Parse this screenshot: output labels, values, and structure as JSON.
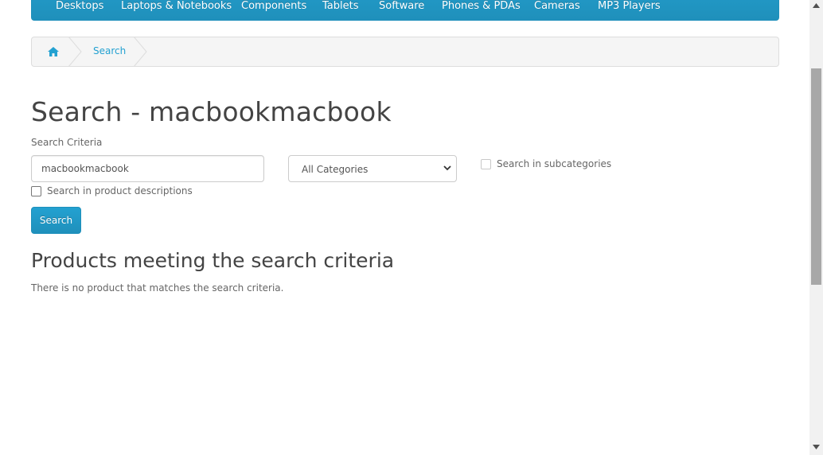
{
  "menu": {
    "items": [
      {
        "label": "Desktops"
      },
      {
        "label": "Laptops & Notebooks"
      },
      {
        "label": "Components"
      },
      {
        "label": "Tablets"
      },
      {
        "label": "Software"
      },
      {
        "label": "Phones & PDAs"
      },
      {
        "label": "Cameras"
      },
      {
        "label": "MP3 Players"
      }
    ]
  },
  "breadcrumb": {
    "home_icon": "home-icon",
    "current": "Search"
  },
  "page": {
    "title": "Search - macbookmacbook",
    "criteria_label": "Search Criteria"
  },
  "form": {
    "search_value": "macbookmacbook",
    "category_selected": "All Categories",
    "subcategories_label": "Search in subcategories",
    "descriptions_label": "Search in product descriptions",
    "search_button": "Search"
  },
  "results": {
    "heading": "Products meeting the search criteria",
    "empty_message": "There is no product that matches the search criteria."
  },
  "colors": {
    "accent": "#229ac8",
    "link": "#23a1d1"
  }
}
